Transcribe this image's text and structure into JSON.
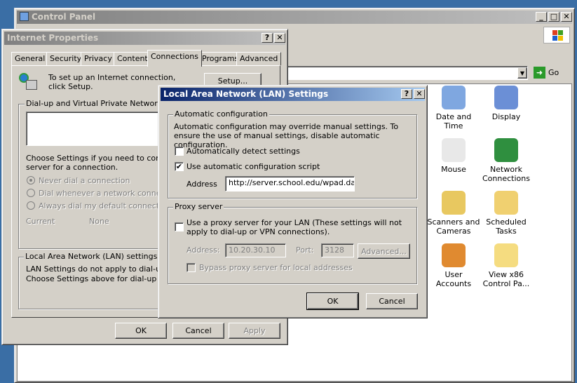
{
  "control_panel": {
    "title": "Control Panel",
    "go_label": "Go",
    "items": [
      {
        "label": "Date and Time",
        "icon": "date-time-icon",
        "color": "#7fa7e0"
      },
      {
        "label": "Display",
        "icon": "display-icon",
        "color": "#6b8fd6"
      },
      {
        "label": "Mouse",
        "icon": "mouse-icon",
        "color": "#e8e8e8"
      },
      {
        "label": "Network Connections",
        "icon": "network-globe-icon",
        "color": "#2f8f3f"
      },
      {
        "label": "Scanners and Cameras",
        "icon": "scanner-camera-icon",
        "color": "#e8c860"
      },
      {
        "label": "Scheduled Tasks",
        "icon": "scheduled-tasks-icon",
        "color": "#f0d070"
      },
      {
        "label": "User Accounts",
        "icon": "user-accounts-icon",
        "color": "#e08a30"
      },
      {
        "label": "View x86 Control Pa...",
        "icon": "folder-icon",
        "color": "#f5dc80"
      }
    ]
  },
  "internet_properties": {
    "title": "Internet Properties",
    "tabs": [
      "General",
      "Security",
      "Privacy",
      "Content",
      "Connections",
      "Programs",
      "Advanced"
    ],
    "active_tab": "Connections",
    "setup_text": "To set up an Internet connection, click Setup.",
    "setup_button": "Setup...",
    "dialup_group": "Dial-up and Virtual Private Network setti",
    "choose_text_1": "Choose Settings if you need to configu",
    "choose_text_2": "server for a connection.",
    "radio_never": "Never dial a connection",
    "radio_whenever": "Dial whenever a network connection",
    "radio_always": "Always dial my default connection",
    "current_label": "Current",
    "current_value": "None",
    "lan_group": "Local Area Network (LAN) settings",
    "lan_text_1": "LAN Settings do not apply to dial-up co",
    "lan_text_2": "Choose Settings above for dial-up setti",
    "ok": "OK",
    "cancel": "Cancel",
    "apply": "Apply"
  },
  "lan_dialog": {
    "title": "Local Area Network (LAN) Settings",
    "auto_group": "Automatic configuration",
    "auto_text": "Automatic configuration may override manual settings.  To ensure the use of manual settings, disable automatic configuration.",
    "auto_detect": {
      "label": "Automatically detect settings",
      "checked": false
    },
    "auto_script": {
      "label": "Use automatic configuration script",
      "checked": true
    },
    "address_label": "Address",
    "address_value": "http://server.school.edu/wpad.dat",
    "proxy_group": "Proxy server",
    "use_proxy": {
      "label": "Use a proxy server for your LAN (These settings will not apply to dial-up or VPN connections).",
      "checked": false
    },
    "proxy_address_label": "Address:",
    "proxy_address_value": "10.20.30.10",
    "port_label": "Port:",
    "port_value": "3128",
    "advanced_button": "Advanced...",
    "bypass": {
      "label": "Bypass proxy server for local addresses",
      "checked": false
    },
    "ok": "OK",
    "cancel": "Cancel",
    "help": "?",
    "close": "✕"
  }
}
